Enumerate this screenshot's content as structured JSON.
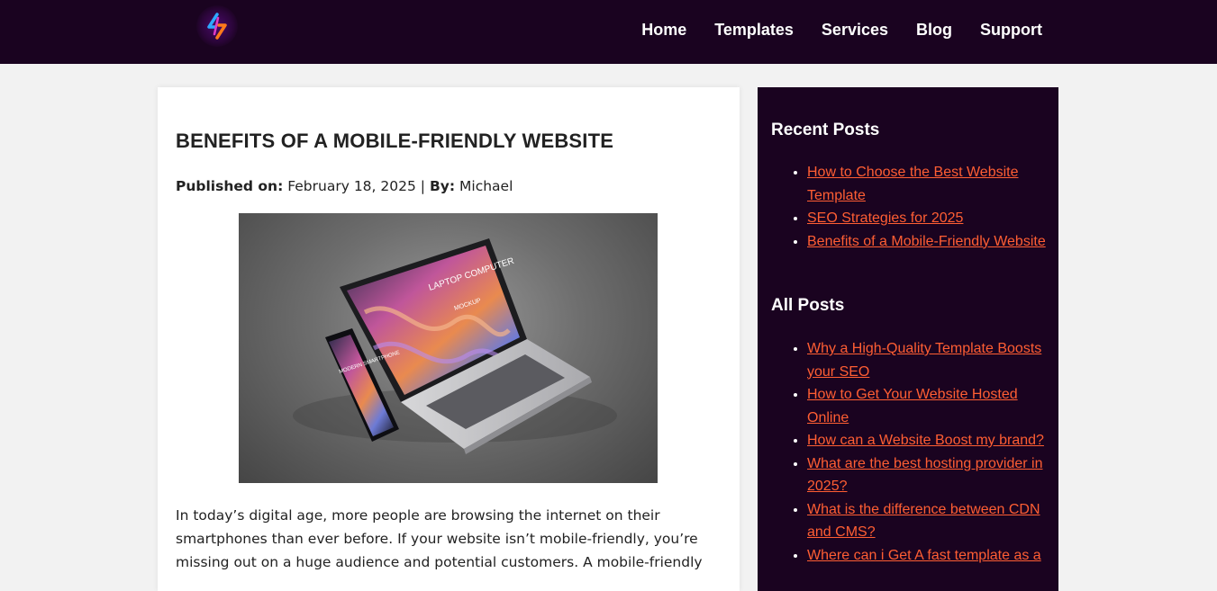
{
  "header": {
    "logo_icon": "lightning-bolt-logo-icon",
    "nav": [
      {
        "label": "Home"
      },
      {
        "label": "Templates"
      },
      {
        "label": "Services"
      },
      {
        "label": "Blog"
      },
      {
        "label": "Support"
      }
    ]
  },
  "post": {
    "title": "BENEFITS OF A MOBILE-FRIENDLY WEBSITE",
    "published_label": "Published on:",
    "date": "February 18, 2025",
    "separator": "|",
    "by_label": "By:",
    "author": "Michael",
    "image": {
      "laptop_text": "LAPTOP COMPUTER",
      "laptop_sub": "MOCKUP",
      "phone_text": "MODERN SMARTPHONE"
    },
    "intro": "In today’s digital age, more people are browsing the internet on their smartphones than ever before. If your website isn’t mobile-friendly, you’re missing out on a huge audience and potential customers. A mobile-friendly"
  },
  "sidebar": {
    "recent_title": "Recent Posts",
    "recent": [
      "How to Choose the Best Website Template",
      "SEO Strategies for 2025",
      "Benefits of a Mobile-Friendly Website"
    ],
    "all_title": "All Posts",
    "all": [
      "Why a High-Quality Template Boosts your SEO",
      "How to Get Your Website Hosted Online",
      "How can a Website Boost my brand?",
      "What are the best hosting provider in 2025?",
      "What is the difference between CDN and CMS?",
      "Where can i Get A fast template as a"
    ]
  },
  "colors": {
    "header_bg": "#1a0320",
    "sidebar_bg": "#1a0320",
    "link": "#ff5e33",
    "page_bg": "#f2f2f2"
  }
}
